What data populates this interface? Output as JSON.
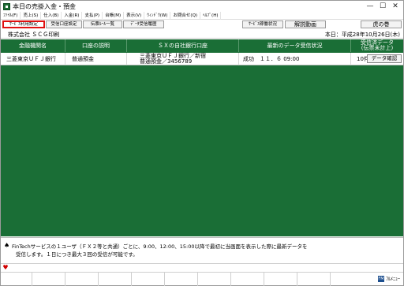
{
  "window": {
    "title": "本日の売掛入金・預金",
    "controls": [
      "—",
      "☐",
      "✕"
    ]
  },
  "menu": [
    "ﾌｧｲﾙ(F)",
    "売上(S)",
    "仕入(B)",
    "入金(R)",
    "支払(P)",
    "台帳(M)",
    "表示(V)",
    "ｳｨﾝﾄﾞｳ(W)",
    "お問合せ(Q)",
    "ﾍﾙﾌﾟ(H)"
  ],
  "toolbar": {
    "service_settings": "ｻｰﾋﾞｽ利用設定",
    "account_settings": "受信口座設定",
    "slip_list": "伝票ﾙｰﾙ一覧",
    "data_receive_history": "ﾃﾞｰﾀ受信履歴",
    "service_status": "ｻｰﾋﾞｽ稼働状況",
    "tutorial_video": "解説動画",
    "tora_no_maki": "虎の巻"
  },
  "info": {
    "company": "株式会社 ＳＣＧ印刷",
    "date": "本日：平成28年10月26日(木)"
  },
  "table": {
    "headers": [
      "金融機関名",
      "口座の説明",
      "ＳＸの自社銀行口座",
      "最新のデータ受信状況",
      "受信済データ",
      "(伝票未計上)"
    ],
    "rows": [
      {
        "bank": "三菱東京ＵＦＪ銀行",
        "description": "普通預金",
        "account_line1": "三菱東京ＵＦＪ銀行／新宿",
        "account_line2": "普通預金／3456789",
        "status": "成功　１１．６ 09:00",
        "count": "10件",
        "button": "データ確認"
      }
    ]
  },
  "notice": {
    "line1": "FinTechサービスの１ユーザ（ＦＸ２等と共通）ごとに、9:00、12:00、15:00以降で最初に当画面を表示した際に最新データを",
    "line2": "受信します。１日につき最大３回の受信が可能です。"
  },
  "footer": {
    "full_menu": "ﾌﾙﾒﾆｭｰ",
    "full_menu_icon": "FM"
  }
}
